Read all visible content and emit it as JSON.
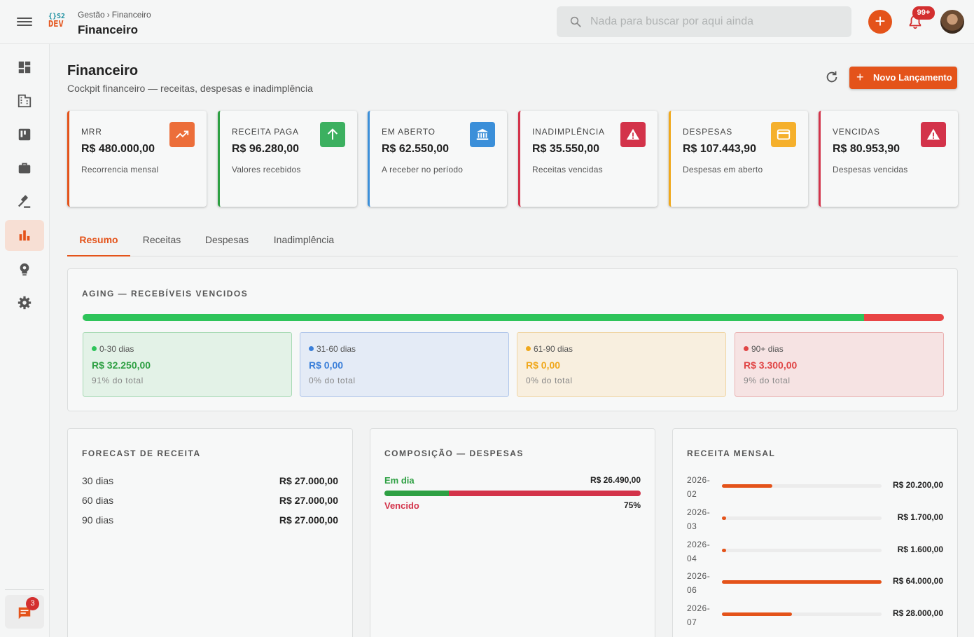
{
  "header": {
    "logo_top": "{}S2",
    "logo_bottom": "DEV",
    "breadcrumb": [
      "Gestão",
      "Financeiro"
    ],
    "title": "Financeiro",
    "search_placeholder": "Nada para buscar por aqui ainda",
    "notifications_badge": "99+"
  },
  "sidebar": {
    "items": [
      {
        "icon": "dashboard-icon",
        "active": false
      },
      {
        "icon": "building-icon",
        "active": false
      },
      {
        "icon": "kanban-icon",
        "active": false
      },
      {
        "icon": "briefcase-icon",
        "active": false
      },
      {
        "icon": "gavel-icon",
        "active": false
      },
      {
        "icon": "bar-chart-icon",
        "active": true
      },
      {
        "icon": "gear-bulb-icon",
        "active": false
      },
      {
        "icon": "settings-icon",
        "active": false
      }
    ],
    "chat_badge": "3"
  },
  "page": {
    "title": "Financeiro",
    "subtitle": "Cockpit financeiro — receitas, despesas e inadimplência",
    "new_button": "Novo Lançamento"
  },
  "kpis": [
    {
      "label": "MRR",
      "value": "R$ 480.000,00",
      "desc": "Recorrencia mensal",
      "color": "#e4531a",
      "icon": "trending-up-icon"
    },
    {
      "label": "Receita paga",
      "value": "R$ 96.280,00",
      "desc": "Valores recebidos",
      "color": "#2ea043",
      "icon": "arrow-up-icon"
    },
    {
      "label": "Em aberto",
      "value": "R$ 62.550,00",
      "desc": "A receber no período",
      "color": "#3b8fd9",
      "icon": "bank-icon"
    },
    {
      "label": "Inadimplência",
      "value": "R$ 35.550,00",
      "desc": "Receitas vencidas",
      "color": "#d3334a",
      "icon": "warning-icon"
    },
    {
      "label": "Despesas",
      "value": "R$ 107.443,90",
      "desc": "Despesas em aberto",
      "color": "#f0a81c",
      "icon": "card-icon"
    },
    {
      "label": "Vencidas",
      "value": "R$ 80.953,90",
      "desc": "Despesas vencidas",
      "color": "#d3334a",
      "icon": "warning-icon"
    }
  ],
  "tabs": [
    "Resumo",
    "Receitas",
    "Despesas",
    "Inadimplência"
  ],
  "aging": {
    "title": "Aging — Recebíveis vencidos",
    "bar": [
      {
        "pct": 0.907,
        "color": "#2ec45a"
      },
      {
        "pct": 0.093,
        "color": "#e84545"
      }
    ],
    "buckets": [
      {
        "label": "0-30 dias",
        "value": "R$ 32.250,00",
        "pct": "91% do total",
        "color": "#2ec45a",
        "bg": "#e3f2e7",
        "border": "#a8dab5"
      },
      {
        "label": "31-60 dias",
        "value": "R$ 0,00",
        "pct": "0% do total",
        "color": "#3b7fd9",
        "bg": "#e4ebf6",
        "border": "#b0c6ea"
      },
      {
        "label": "61-90 dias",
        "value": "R$ 0,00",
        "pct": "0% do total",
        "color": "#f0a81c",
        "bg": "#f8efdf",
        "border": "#f0d5a4"
      },
      {
        "label": "90+ dias",
        "value": "R$ 3.300,00",
        "pct": "9% do total",
        "color": "#e04545",
        "bg": "#f6e3e3",
        "border": "#eab1b1"
      }
    ]
  },
  "forecast": {
    "title": "Forecast de receita",
    "rows": [
      {
        "label": "30 dias",
        "value": "R$ 27.000,00"
      },
      {
        "label": "60 dias",
        "value": "R$ 27.000,00"
      },
      {
        "label": "90 dias",
        "value": "R$ 27.000,00"
      }
    ]
  },
  "composicao": {
    "title": "Composição — Despesas",
    "em_dia_label": "Em dia",
    "em_dia_value": "R$ 26.490,00",
    "vencido_label": "Vencido",
    "vencido_value": "75%",
    "em_dia_pct": 0.25,
    "vencido_pct": 0.75
  },
  "receita_mensal": {
    "title": "Receita mensal",
    "rows": [
      {
        "month": "2026-02",
        "value": "R$ 20.200,00",
        "amount": 20200
      },
      {
        "month": "2026-03",
        "value": "R$ 1.700,00",
        "amount": 1700
      },
      {
        "month": "2026-04",
        "value": "R$ 1.600,00",
        "amount": 1600
      },
      {
        "month": "2026-06",
        "value": "R$ 64.000,00",
        "amount": 64000
      },
      {
        "month": "2026-07",
        "value": "R$ 28.000,00",
        "amount": 28000
      }
    ]
  }
}
